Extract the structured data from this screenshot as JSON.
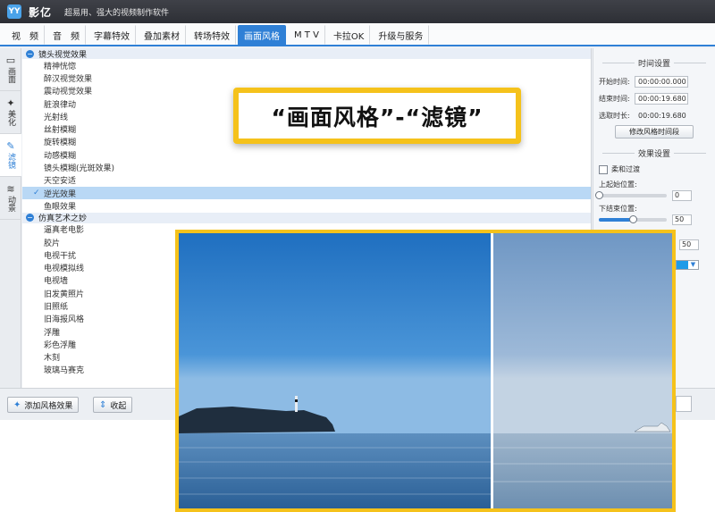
{
  "titlebar": {
    "logo": "YY",
    "app_name": "影亿",
    "slogan": "超易用、强大的视频制作软件"
  },
  "tabs": [
    {
      "label": "视　频",
      "active": false
    },
    {
      "label": "音　频",
      "active": false
    },
    {
      "label": "字幕特效",
      "active": false
    },
    {
      "label": "叠加素材",
      "active": false
    },
    {
      "label": "转场特效",
      "active": false
    },
    {
      "label": "画面风格",
      "active": true
    },
    {
      "label": "M T V",
      "active": false
    },
    {
      "label": "卡拉OK",
      "active": false
    },
    {
      "label": "升级与服务",
      "active": false
    }
  ],
  "leftnav": [
    {
      "label": "画面",
      "icon": "frame-icon"
    },
    {
      "label": "美化",
      "icon": "magic-wand-icon"
    },
    {
      "label": "滤镜",
      "icon": "filter-brush-icon",
      "active": true
    },
    {
      "label": "动景",
      "icon": "motion-icon"
    }
  ],
  "effects": {
    "group1": "镜头视觉效果",
    "group1_items": [
      "精神恍惚",
      "醉汉视觉效果",
      "震动视觉效果",
      "脏浪律动",
      "光射线",
      "丝射模糊",
      "旋转模糊",
      "动感模糊",
      "镜头模糊(光斑效果)",
      "天空安适",
      "逆光效果",
      "鱼眼效果"
    ],
    "selected": "逆光效果",
    "group2": "仿真艺术之妙",
    "group2_items": [
      "逼真老电影",
      "胶片",
      "电视干扰",
      "电视模拟线",
      "电视墙",
      "旧发黄照片",
      "旧照纸",
      "旧海报风格",
      "浮雕",
      "彩色浮雕",
      "木刻",
      "玻璃马赛克"
    ]
  },
  "rightpanel": {
    "time_title": "时间设置",
    "start_label": "开始时间:",
    "start_value": "00:00:00.000",
    "end_label": "结束时间:",
    "end_value": "00:00:19.680",
    "duration_label": "选取时长:",
    "duration_value": "00:00:19.680",
    "modify_button": "修改风格时间段",
    "effect_title": "效果设置",
    "soft_filter": "柔和过渡",
    "top_label": "上起始位置:",
    "top_value": "0",
    "top_fraction": 0.0,
    "bottom_label": "下结束位置:",
    "bottom_value": "50",
    "bottom_fraction": 0.5,
    "extra_value": "50",
    "accent_color": "#1e9be8"
  },
  "bottom": {
    "add_button": "添加风格效果",
    "collapse_button": "收起"
  },
  "callout": {
    "text": "“画面风格”-“滤镜”"
  },
  "colors": {
    "accent": "#2f80d6",
    "highlight_border": "#f5c21b",
    "selected_row": "#b9d8f5"
  }
}
